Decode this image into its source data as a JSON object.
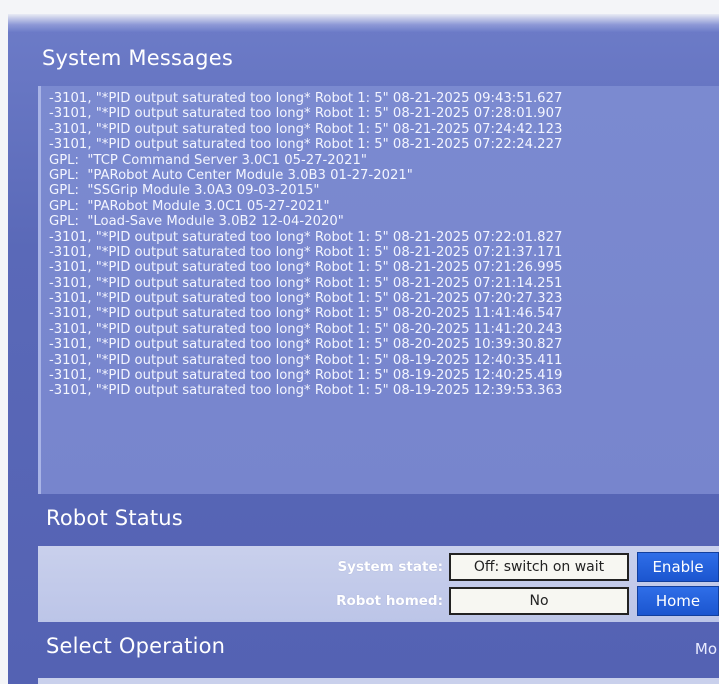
{
  "system_messages": {
    "title": "System Messages",
    "lines": [
      "-3101, \"*PID output saturated too long* Robot 1: 5\" 08-21-2025 09:43:51.627",
      "-3101, \"*PID output saturated too long* Robot 1: 5\" 08-21-2025 07:28:01.907",
      "-3101, \"*PID output saturated too long* Robot 1: 5\" 08-21-2025 07:24:42.123",
      "-3101, \"*PID output saturated too long* Robot 1: 5\" 08-21-2025 07:22:24.227",
      "GPL:  \"TCP Command Server 3.0C1 05-27-2021\"",
      "GPL:  \"PARobot Auto Center Module 3.0B3 01-27-2021\"",
      "GPL:  \"SSGrip Module 3.0A3 09-03-2015\"",
      "GPL:  \"PARobot Module 3.0C1 05-27-2021\"",
      "GPL:  \"Load-Save Module 3.0B2 12-04-2020\"",
      "-3101, \"*PID output saturated too long* Robot 1: 5\" 08-21-2025 07:22:01.827",
      "-3101, \"*PID output saturated too long* Robot 1: 5\" 08-21-2025 07:21:37.171",
      "-3101, \"*PID output saturated too long* Robot 1: 5\" 08-21-2025 07:21:26.995",
      "-3101, \"*PID output saturated too long* Robot 1: 5\" 08-21-2025 07:21:14.251",
      "-3101, \"*PID output saturated too long* Robot 1: 5\" 08-21-2025 07:20:27.323",
      "-3101, \"*PID output saturated too long* Robot 1: 5\" 08-20-2025 11:41:46.547",
      "-3101, \"*PID output saturated too long* Robot 1: 5\" 08-20-2025 11:41:20.243",
      "-3101, \"*PID output saturated too long* Robot 1: 5\" 08-20-2025 10:39:30.827",
      "-3101, \"*PID output saturated too long* Robot 1: 5\" 08-19-2025 12:40:35.411",
      "-3101, \"*PID output saturated too long* Robot 1: 5\" 08-19-2025 12:40:25.419",
      "-3101, \"*PID output saturated too long* Robot 1: 5\" 08-19-2025 12:39:53.363"
    ]
  },
  "robot_status": {
    "title": "Robot Status",
    "system_state_label": "System state:",
    "system_state_value": "Off: switch on wait",
    "enable_button": "Enable",
    "robot_homed_label": "Robot homed:",
    "robot_homed_value": "No",
    "home_button": "Home"
  },
  "select_operation": {
    "title": "Select Operation",
    "mode_label": "Mo"
  },
  "colors": {
    "panel_background": "#5a69b8",
    "message_area": "#7b8ad0",
    "status_panel": "#c9d0ec",
    "button_blue": "#1b55cf"
  }
}
